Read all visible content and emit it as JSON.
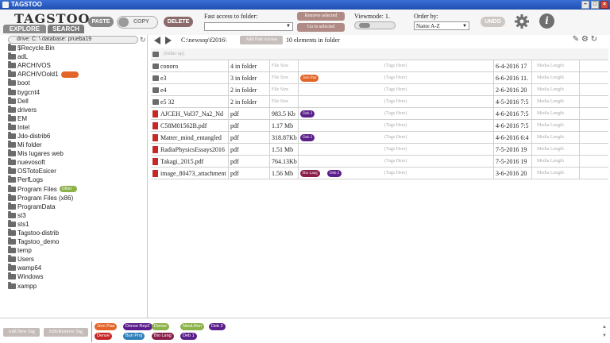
{
  "window": {
    "title": "TAGSTOO",
    "minimize": "–",
    "maximize": "□",
    "close": "×"
  },
  "header": {
    "logo": "TAGSTOO",
    "tabs": {
      "explore": "EXPLORE",
      "search": "SEARCH"
    },
    "paste_label": "PASTE",
    "copy_label": "COPY",
    "delete_label": "DELETE",
    "fast_access_label": "Fast access to folder:",
    "fast_access_value": "",
    "remove_selected_label": "Remove selected",
    "go_selected_label": "Go to selected",
    "viewmode_label": "Viewmode: 1.",
    "viewmode_level": 0.1,
    "orderby_label": "Order by:",
    "orderby_value": "Name A-Z",
    "undo_label": "UNDO",
    "info_glyph": "i"
  },
  "left": {
    "drive_label": "drive: C: \\ database: prueba19",
    "tree": [
      {
        "name": "$Recycle.Bin"
      },
      {
        "name": "adL"
      },
      {
        "name": "ARCHIVOS"
      },
      {
        "name": "ARCHIVOold1",
        "tag": "",
        "tag_color": "#e2662a"
      },
      {
        "name": "boot"
      },
      {
        "name": "bygcnt4"
      },
      {
        "name": "Dell"
      },
      {
        "name": "drivers"
      },
      {
        "name": "EM"
      },
      {
        "name": "Intel"
      },
      {
        "name": "Jdo-distrib6"
      },
      {
        "name": "Mi folder"
      },
      {
        "name": "Mis lugares web"
      },
      {
        "name": "nuevosoft"
      },
      {
        "name": "OSTotoEsicer"
      },
      {
        "name": "PerfLogs"
      },
      {
        "name": "Program Files",
        "tag": "Other",
        "tag_color": "#8cb24a"
      },
      {
        "name": "Program Files (x86)"
      },
      {
        "name": "ProgramData"
      },
      {
        "name": "st3"
      },
      {
        "name": "sts1"
      },
      {
        "name": "Tagstoo-distrib"
      },
      {
        "name": "Tagstoo_demo"
      },
      {
        "name": "temp"
      },
      {
        "name": "Users"
      },
      {
        "name": "wamp64"
      },
      {
        "name": "Windows"
      },
      {
        "name": "xampp"
      }
    ]
  },
  "toolbar": {
    "path": "C:\\newsop\\f2016\\",
    "add_fast_label": "Add Fast Access",
    "count_label": "10 elements in folder",
    "icons": "✎ ⚙ ↻"
  },
  "files": {
    "up_label": "(folder up)",
    "placeholders": {
      "size": "File Size",
      "tags": "(Tags Here)",
      "media": "Media Length"
    },
    "rows": [
      {
        "name": "conoro",
        "type": "4 in folder",
        "size": "",
        "tags": [],
        "date": "6-4-2016 17",
        "kind": "dir"
      },
      {
        "name": "e3",
        "type": "3 in folder",
        "size": "",
        "tags": [
          {
            "label": "Jorn Paa",
            "color": "#e2662a"
          }
        ],
        "date": "6-6-2016 11.",
        "kind": "dir"
      },
      {
        "name": "e4",
        "type": "2 in folder",
        "size": "",
        "tags": [],
        "date": "2-6-2016 20",
        "kind": "dir"
      },
      {
        "name": "e5 32",
        "type": "2 in folder",
        "size": "",
        "tags": [],
        "date": "4-5-2016 7:5",
        "kind": "dir"
      },
      {
        "name": "AJCEH_Vol37_Na2_Nd",
        "type": "pdf",
        "size": "983.5 Kb",
        "tags": [
          {
            "label": "Deb 2",
            "color": "#5a1f8c"
          }
        ],
        "date": "4-6-2016 7:5",
        "kind": "pdf"
      },
      {
        "name": "C58M01562B.pdf",
        "type": "pdf",
        "size": "1.17 Mb",
        "tags": [],
        "date": "4-6-2016 7:5",
        "kind": "pdf"
      },
      {
        "name": "Matter_mind_entangled",
        "type": "pdf",
        "size": "318.87Kb",
        "tags": [
          {
            "label": "Deb 2",
            "color": "#5a1f8c"
          }
        ],
        "date": "4-6-2016 6:4",
        "kind": "pdf"
      },
      {
        "name": "RadiaPhysicsEssays2016",
        "type": "pdf",
        "size": "1.51 Mb",
        "tags": [],
        "date": "7-5-2016 19",
        "kind": "pdf"
      },
      {
        "name": "Takagi_2015.pdf",
        "type": "pdf",
        "size": "764.13Kb",
        "tags": [],
        "date": "7-5-2016 19",
        "kind": "pdf"
      },
      {
        "name": "image_80473_attachment",
        "type": "pdf",
        "size": "1.56 Mb",
        "tags": [
          {
            "label": "Bio Lang",
            "color": "#8b1e4a"
          },
          {
            "label": "Deb 2",
            "color": "#5a1f8c"
          }
        ],
        "date": "3-6-2016 20",
        "kind": "pdf"
      }
    ]
  },
  "bottom": {
    "add_tag_label": "Add New Tag",
    "edit_tag_label": "Edit/Remove Tag",
    "tag_pool": [
      {
        "label": "Jorn Paa",
        "color": "#e2662a"
      },
      {
        "label": "Dense Rep2",
        "color": "#5a1f8c"
      },
      {
        "label": "Dense",
        "color": "#8cb24a"
      },
      {
        "label": "NewLRen",
        "color": "#8cb24a"
      },
      {
        "label": "Deb 2",
        "color": "#5a1f8c"
      },
      {
        "label": "Dense",
        "color": "#c62828"
      },
      {
        "label": "Bun Proj",
        "color": "#2f7fb8"
      },
      {
        "label": "Bio Lang",
        "color": "#8b1e4a"
      },
      {
        "label": "Deb 1",
        "color": "#5a1f8c"
      }
    ]
  },
  "colors": {
    "accent": "#2f62c9",
    "folder": "#6b6b6b",
    "pdf": "#c62828"
  }
}
